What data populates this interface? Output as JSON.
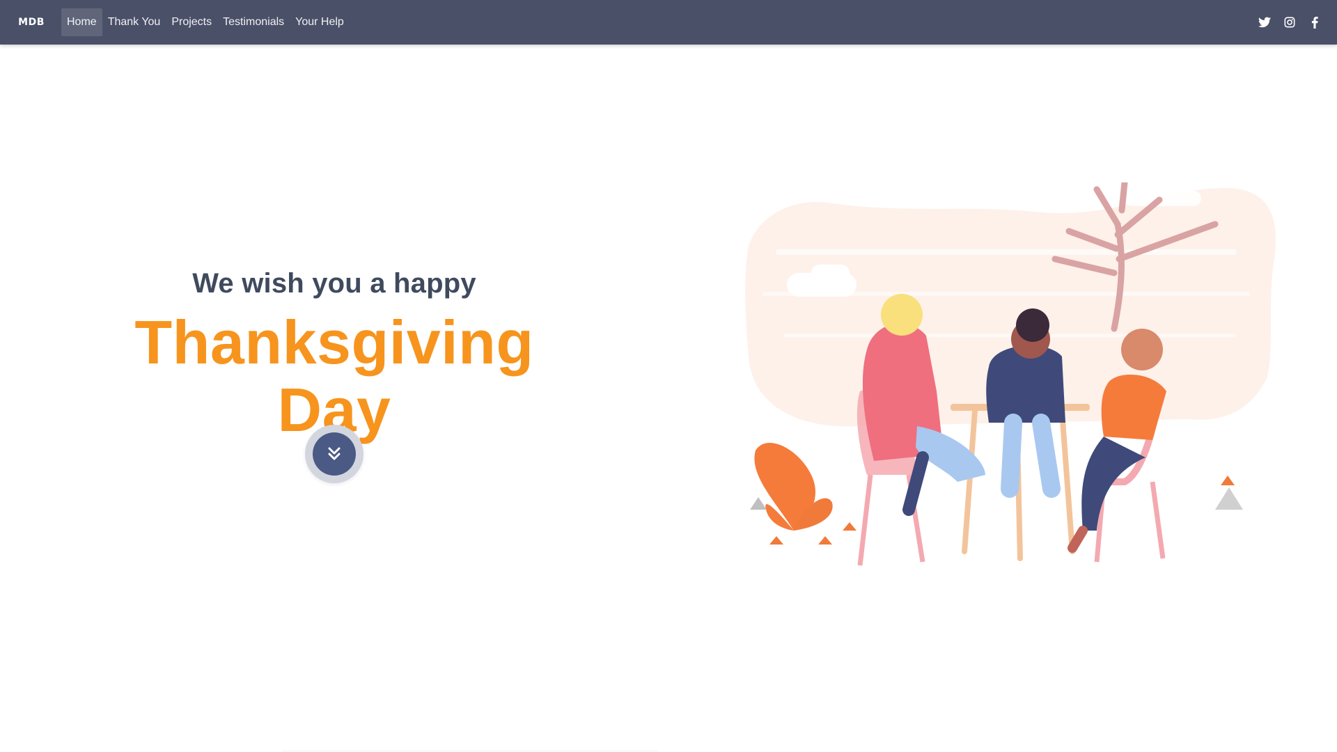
{
  "navbar": {
    "brand": "MDB",
    "links": [
      {
        "label": "Home",
        "active": true
      },
      {
        "label": "Thank You",
        "active": false
      },
      {
        "label": "Projects",
        "active": false
      },
      {
        "label": "Testimonials",
        "active": false
      },
      {
        "label": "Your Help",
        "active": false
      }
    ],
    "social_icons": [
      "twitter-icon",
      "instagram-icon",
      "facebook-icon"
    ],
    "background_color": "#4a5068"
  },
  "hero": {
    "subtitle": "We wish you a happy",
    "title": "Thanksgiving Day",
    "scroll_icon": "chevron-double-down-icon",
    "subtitle_color": "#3f4a5e",
    "title_color": "#f7941d",
    "button_color": "#4a5a85"
  },
  "illustration": {
    "subject": "four-people-at-table-under-tree"
  }
}
